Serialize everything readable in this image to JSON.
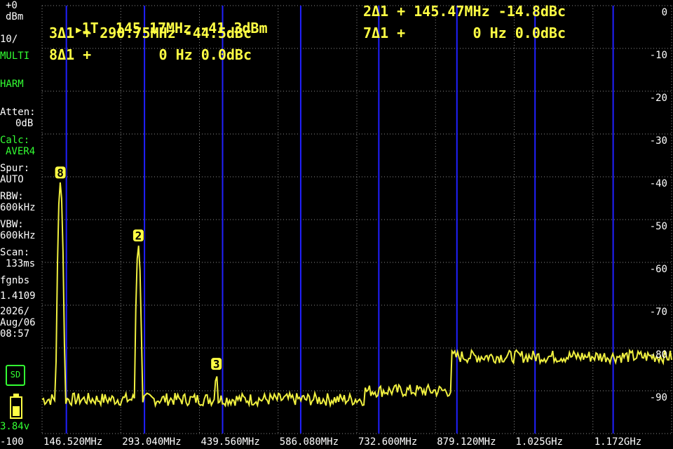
{
  "left_panel": {
    "ref_level": "+0",
    "unit": "dBm",
    "scale": "10/",
    "mode1": "MULTI",
    "mode2": "HARM",
    "atten_label": "Atten:",
    "atten_value": "0dB",
    "calc_label": "Calc:",
    "calc_value": "AVER4",
    "spur_label": "Spur:",
    "spur_value": "AUTO",
    "rbw_label": "RBW:",
    "rbw_value": "600kHz",
    "vbw_label": "VBW:",
    "vbw_value": "600kHz",
    "scan_label": "Scan:",
    "scan_value": "133ms",
    "fgnbs_label": "fgnbs",
    "fgnbs_value": "1.4109",
    "date_year": "2026/",
    "date_day": "Aug/06",
    "time": "08:57",
    "sd_label": "SD",
    "battery_voltage": "3.84v",
    "bottom_ref": "-100"
  },
  "markers": [
    {
      "id": "1",
      "text": "1T  145.17MHz -41.3dBm"
    },
    {
      "id": "2",
      "text": "2Δ1 + 145.47MHz -14.8dBc"
    },
    {
      "id": "3",
      "text": "3Δ1 + 290.75MHz -44.5dBc"
    },
    {
      "id": "7",
      "text": "7Δ1 +        0 Hz 0.0dBc"
    },
    {
      "id": "8",
      "text": "8Δ1 +        0 Hz 0.0dBc"
    }
  ],
  "trace_markers": [
    {
      "label": "8",
      "freq_index": 0
    },
    {
      "label": "2",
      "freq_index": 1
    },
    {
      "label": "3",
      "freq_index": 2
    }
  ],
  "colors": {
    "trace": "#f0f040",
    "marker_text": "#ffff44",
    "harmonic_lines": "#2020ff",
    "grid": "#8a8a8a",
    "status_green": "#33ff33"
  },
  "chart_data": {
    "type": "line",
    "title": "",
    "xlabel": "",
    "ylabel": "",
    "ylim": [
      -100,
      0
    ],
    "y_ticks": [
      "0",
      "-10",
      "-20",
      "-30",
      "-40",
      "-50",
      "-60",
      "-70",
      "-80",
      "-90"
    ],
    "x_tick_labels": [
      "146.520MHz",
      "293.040MHz",
      "439.560MHz",
      "586.080MHz",
      "732.600MHz",
      "879.120MHz",
      "1.025GHz",
      "1.172GHz"
    ],
    "x_range_mhz": [
      100,
      1270
    ],
    "harmonic_lines_mhz": [
      145.17,
      290.34,
      435.51,
      580.68,
      725.85,
      871.02,
      1016.19,
      1161.36
    ],
    "peaks": [
      {
        "freq_mhz": 134,
        "level_dbm": -41.3
      },
      {
        "freq_mhz": 279,
        "level_dbm": -56.0
      },
      {
        "freq_mhz": 424,
        "level_dbm": -86.0
      }
    ],
    "noise_floor": [
      {
        "from_mhz": 100,
        "to_mhz": 700,
        "level_dbm": -92
      },
      {
        "from_mhz": 700,
        "to_mhz": 860,
        "level_dbm": -90
      },
      {
        "from_mhz": 860,
        "to_mhz": 1270,
        "level_dbm": -82
      }
    ],
    "grid": true
  }
}
